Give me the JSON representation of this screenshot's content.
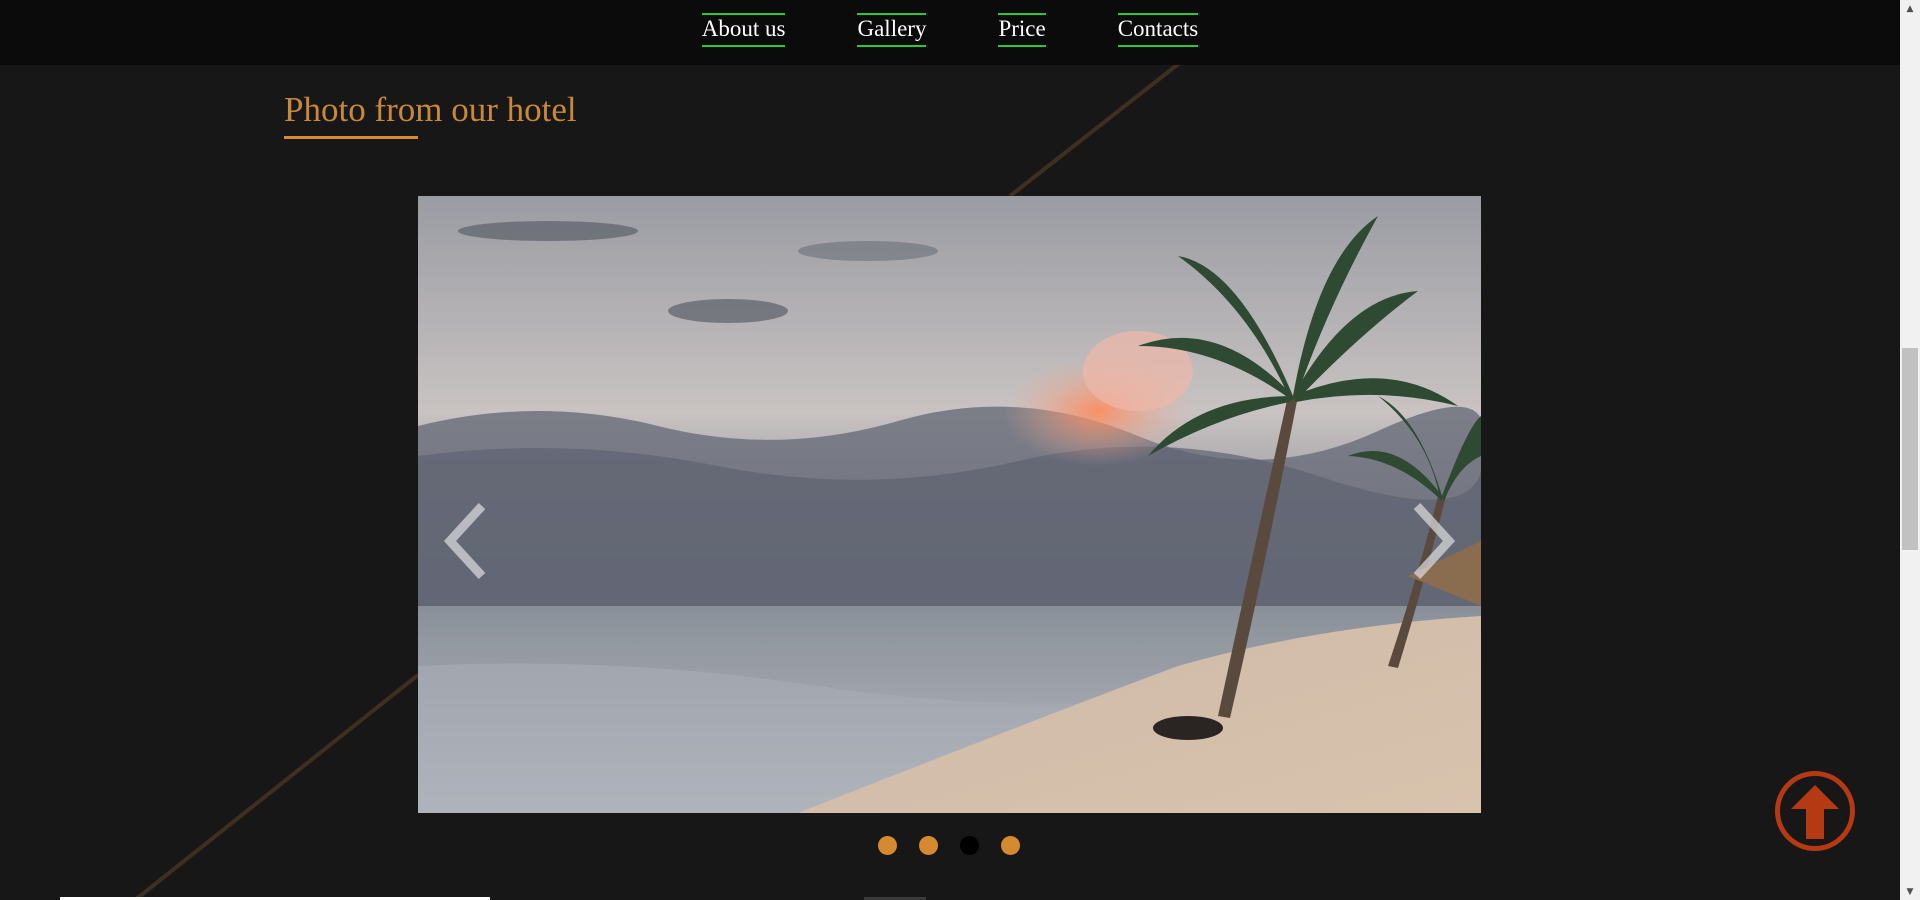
{
  "nav": {
    "items": [
      {
        "label": "About us"
      },
      {
        "label": "Gallery"
      },
      {
        "label": "Price"
      },
      {
        "label": "Contacts"
      }
    ]
  },
  "section": {
    "title": "Photo from our hotel"
  },
  "carousel": {
    "slides_total": 4,
    "active_slide": 3,
    "prev_icon": "chevron-left-icon",
    "next_icon": "chevron-right-icon"
  },
  "back_to_top": {
    "icon": "arrow-up-circle-icon"
  },
  "colors": {
    "accent": "#d68a30",
    "nav_underline": "#2bc83a",
    "back_to_top": "#b53a14",
    "background": "#171717"
  }
}
